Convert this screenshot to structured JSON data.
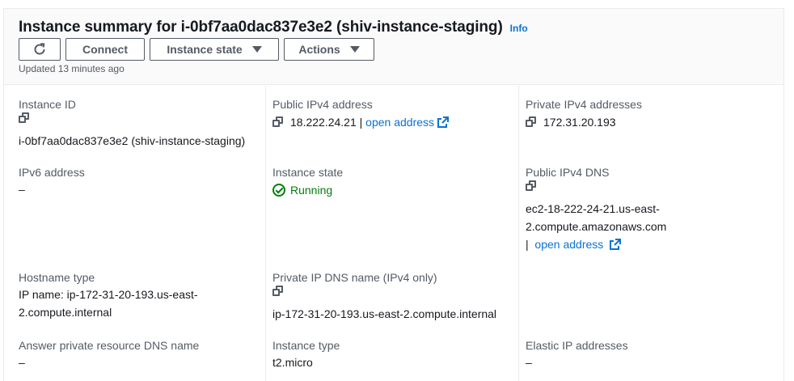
{
  "header": {
    "title": "Instance summary for i-0bf7aa0dac837e3e2 (shiv-instance-staging)",
    "info_label": "Info",
    "buttons": {
      "refresh_icon": "refresh-icon",
      "connect": "Connect",
      "instance_state": "Instance state",
      "actions": "Actions"
    },
    "updated": "Updated 13 minutes ago"
  },
  "fields": {
    "instance_id": {
      "label": "Instance ID",
      "value": "i-0bf7aa0dac837e3e2 (shiv-instance-staging)"
    },
    "public_ipv4": {
      "label": "Public IPv4 address",
      "value": "18.222.24.21",
      "separator": " | ",
      "link": "open address"
    },
    "private_ipv4": {
      "label": "Private IPv4 addresses",
      "value": "172.31.20.193"
    },
    "ipv6": {
      "label": "IPv6 address",
      "value": "–"
    },
    "instance_state": {
      "label": "Instance state",
      "value": "Running"
    },
    "public_dns": {
      "label": "Public IPv4 DNS",
      "value_line1": "ec2-18-222-24-21.us-east-",
      "value_line2": "2.compute.amazonaws.com",
      "separator": "| ",
      "link": "open address"
    },
    "hostname_type": {
      "label": "Hostname type",
      "value_line1": "IP name: ip-172-31-20-193.us-east-",
      "value_line2": "2.compute.internal"
    },
    "private_dns": {
      "label": "Private IP DNS name (IPv4 only)",
      "value": "ip-172-31-20-193.us-east-2.compute.internal"
    },
    "answer_dns": {
      "label": "Answer private resource DNS name",
      "value": "–"
    },
    "instance_type": {
      "label": "Instance type",
      "value": "t2.micro"
    },
    "elastic_ip": {
      "label": "Elastic IP addresses",
      "value": "–"
    }
  },
  "colors": {
    "link": "#0972d3",
    "running": "#037f0c",
    "label": "#545b64",
    "text": "#16191f"
  }
}
